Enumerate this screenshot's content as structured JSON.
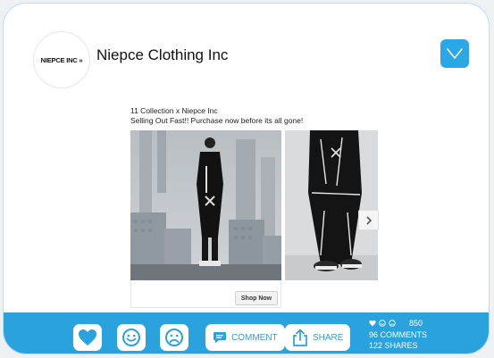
{
  "post": {
    "logo_text": "NIEPCE INC »",
    "page_name": "Niepce Clothing Inc",
    "caption_line1": "11 Collection x Niepce Inc",
    "caption_line2": "Selling Out Fast!! Purchase now before its all gone!",
    "cta_label": "Shop Now",
    "accent_color": "#2aa2de"
  },
  "actions": {
    "comment_label": "COMMENT",
    "share_label": "SHARE"
  },
  "stats": {
    "reactions": "850",
    "comments": "96 COMMENTS",
    "shares": "122 SHARES"
  }
}
